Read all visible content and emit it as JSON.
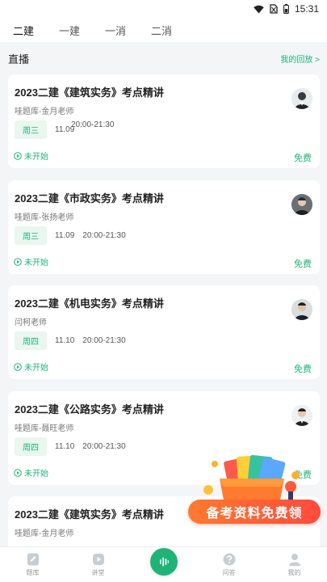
{
  "status_bar": {
    "time": "15:31"
  },
  "top_tabs": [
    {
      "label": "二建",
      "active": true
    },
    {
      "label": "一建",
      "active": false
    },
    {
      "label": "一消",
      "active": false
    },
    {
      "label": "二消",
      "active": false
    }
  ],
  "section": {
    "title": "直播",
    "replay_link": "我的回放 >"
  },
  "courses": [
    {
      "title": "2023二建《建筑实务》考点精讲",
      "teacher": "哇题库-金月老师",
      "weekday": "周三",
      "date": "11.09",
      "time": "20:00-21:30",
      "status": "未开始",
      "price": "免费"
    },
    {
      "title": "2023二建《市政实务》考点精讲",
      "teacher": "哇题库-张扬老师",
      "weekday": "周三",
      "date": "11.09",
      "time": "20:00-21:30",
      "status": "未开始",
      "price": "免费"
    },
    {
      "title": "2023二建《机电实务》考点精讲",
      "teacher": "闫柯老师",
      "weekday": "周四",
      "date": "11.10",
      "time": "20:00-21:30",
      "status": "未开始",
      "price": "免费"
    },
    {
      "title": "2023二建《公路实务》考点精讲",
      "teacher": "哇题库-聂旺老师",
      "weekday": "周四",
      "date": "11.10",
      "time": "20:00-21:30",
      "status": "未开始",
      "price": "免费"
    },
    {
      "title": "2023二建《建筑实务》考点精讲",
      "teacher": "哇题库-金月老师",
      "weekday": "",
      "date": "",
      "time": "",
      "status": "",
      "price": ""
    }
  ],
  "promo": {
    "label": "备考资料免费领"
  },
  "bottom_nav": [
    {
      "label": "题库",
      "icon": "question-bank-icon"
    },
    {
      "label": "讲堂",
      "icon": "lecture-play-icon"
    },
    {
      "label": "",
      "icon": "voice-wave-icon"
    },
    {
      "label": "问答",
      "icon": "question-mark-icon"
    },
    {
      "label": "我的",
      "icon": "profile-icon"
    }
  ],
  "colors": {
    "accent": "#1fb37a",
    "promo": "#ff5a3a"
  }
}
